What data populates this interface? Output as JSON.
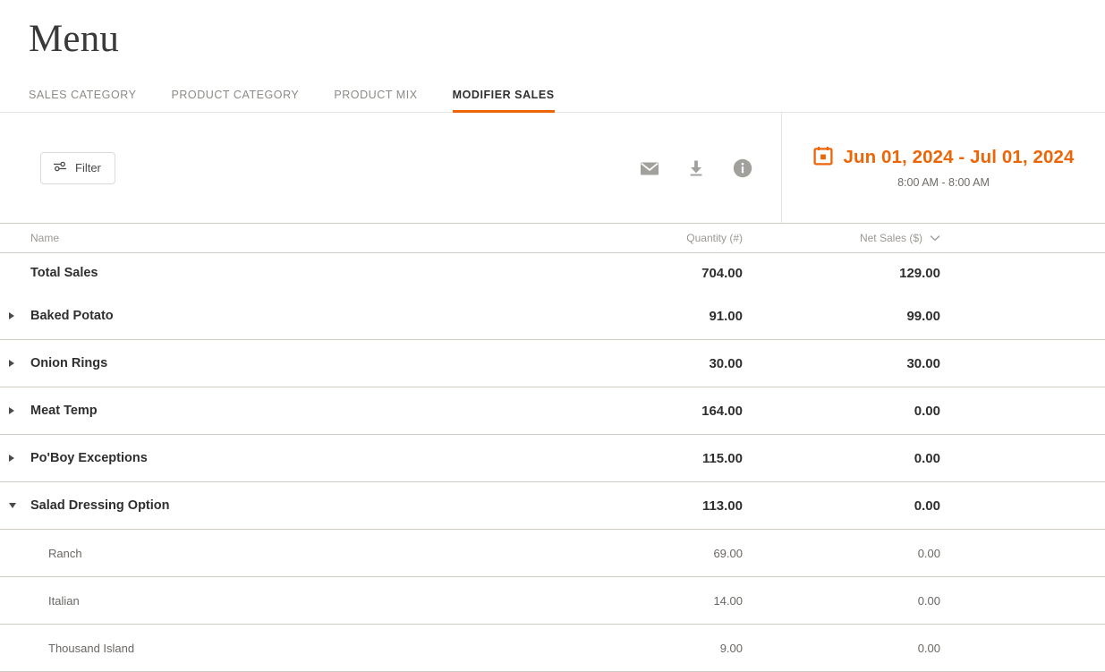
{
  "header": {
    "title": "Menu"
  },
  "tabs": [
    {
      "label": "SALES CATEGORY",
      "active": false
    },
    {
      "label": "PRODUCT CATEGORY",
      "active": false
    },
    {
      "label": "PRODUCT MIX",
      "active": false
    },
    {
      "label": "MODIFIER SALES",
      "active": true
    }
  ],
  "toolbar": {
    "filter_label": "Filter",
    "filter_icon": "sliders-icon",
    "icons": [
      {
        "name": "email-icon"
      },
      {
        "name": "download-icon"
      },
      {
        "name": "info-icon"
      }
    ]
  },
  "daterange": {
    "icon": "calendar-icon",
    "range": "Jun 01, 2024 - Jul 01, 2024",
    "time": "8:00 AM - 8:00 AM",
    "accent_color": "#ec6608"
  },
  "table": {
    "columns": {
      "name": "Name",
      "quantity": "Quantity (#)",
      "net_sales": "Net Sales ($)"
    },
    "sort_icon": "chevron-down-icon",
    "rows": [
      {
        "type": "total",
        "name": "Total Sales",
        "quantity": "704.00",
        "net_sales": "129.00"
      },
      {
        "type": "parent",
        "name": "Baked Potato",
        "quantity": "91.00",
        "net_sales": "99.00",
        "expanded": false
      },
      {
        "type": "parent",
        "name": "Onion Rings",
        "quantity": "30.00",
        "net_sales": "30.00",
        "expanded": false
      },
      {
        "type": "parent",
        "name": "Meat Temp",
        "quantity": "164.00",
        "net_sales": "0.00",
        "expanded": false
      },
      {
        "type": "parent",
        "name": "Po'Boy Exceptions",
        "quantity": "115.00",
        "net_sales": "0.00",
        "expanded": false
      },
      {
        "type": "parent",
        "name": "Salad Dressing Option",
        "quantity": "113.00",
        "net_sales": "0.00",
        "expanded": true
      },
      {
        "type": "child",
        "name": "Ranch",
        "quantity": "69.00",
        "net_sales": "0.00"
      },
      {
        "type": "child",
        "name": "Italian",
        "quantity": "14.00",
        "net_sales": "0.00"
      },
      {
        "type": "child",
        "name": "Thousand Island",
        "quantity": "9.00",
        "net_sales": "0.00"
      }
    ]
  }
}
